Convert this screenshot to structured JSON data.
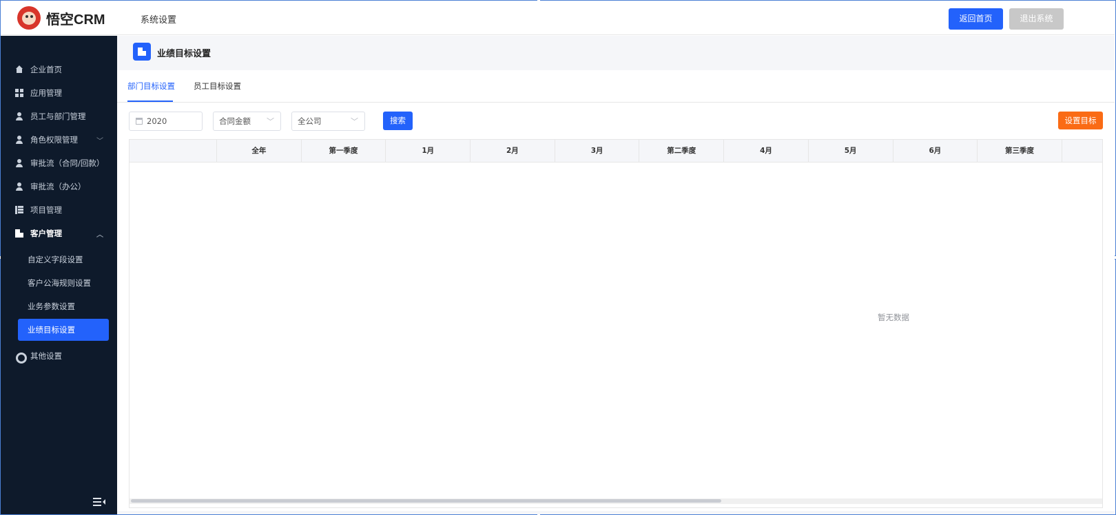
{
  "brand": {
    "name": "悟空CRM"
  },
  "header": {
    "title": "系统设置",
    "home_button": "返回首页",
    "exit_button": "退出系统"
  },
  "sidebar": {
    "items": [
      {
        "label": "企业首页",
        "icon": "home-icon"
      },
      {
        "label": "应用管理",
        "icon": "grid-icon"
      },
      {
        "label": "员工与部门管理",
        "icon": "users-icon"
      },
      {
        "label": "角色权限管理",
        "icon": "user-icon"
      },
      {
        "label": "审批流（合同/回款）",
        "icon": "user-icon"
      },
      {
        "label": "审批流（办公）",
        "icon": "user-icon"
      },
      {
        "label": "项目管理",
        "icon": "list-icon"
      },
      {
        "label": "客户管理",
        "icon": "building-icon"
      }
    ],
    "sub_items": [
      {
        "label": "自定义字段设置"
      },
      {
        "label": "客户公海规则设置"
      },
      {
        "label": "业务参数设置"
      },
      {
        "label": "业绩目标设置",
        "active": true
      }
    ],
    "other": {
      "label": "其他设置",
      "icon": "gear-icon"
    }
  },
  "page": {
    "title": "业绩目标设置",
    "tabs": [
      {
        "label": "部门目标设置",
        "active": true
      },
      {
        "label": "员工目标设置",
        "active": false
      }
    ],
    "filters": {
      "year": "2020",
      "metric": "合同金额",
      "scope": "全公司"
    },
    "search_button": "搜索",
    "set_target_button": "设置目标",
    "table": {
      "columns": [
        "",
        "全年",
        "第一季度",
        "1月",
        "2月",
        "3月",
        "第二季度",
        "4月",
        "5月",
        "6月",
        "第三季度"
      ],
      "empty_text": "暂无数据"
    }
  },
  "colors": {
    "primary": "#2362fb",
    "sidebar_bg": "#0e1a2b",
    "orange": "#fa6b15",
    "disabled": "#c8c8c8"
  }
}
